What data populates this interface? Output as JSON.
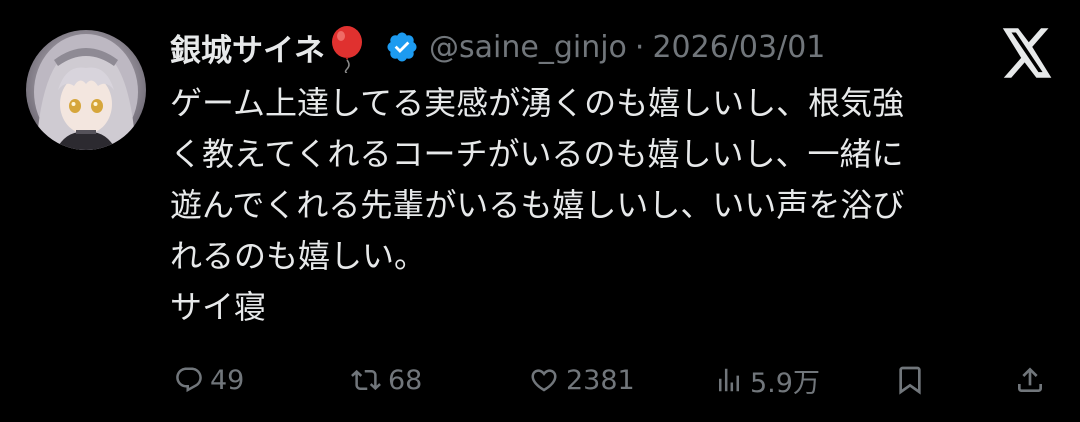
{
  "user": {
    "display_name": "銀城サイネ",
    "handle": "@saine_ginjo",
    "separator": "·",
    "date": "2026/03/01",
    "verified": true,
    "name_emoji": "balloon-icon"
  },
  "tweet": {
    "lines": [
      "ゲーム上達してる実感が湧くのも嬉しいし、根気強",
      "く教えてくれるコーチがいるのも嬉しいし、一緒に",
      "遊んでくれる先輩がいるも嬉しいし、いい声を浴び",
      "れるのも嬉しい。",
      "サイ寝"
    ]
  },
  "actions": {
    "replies": "49",
    "reposts": "68",
    "likes": "2381",
    "views": "5.9万"
  },
  "colors": {
    "background": "#000000",
    "text": "#e7e9ea",
    "muted": "#71767b",
    "verified": "#1d9bf0",
    "balloon": "#e0312f"
  },
  "icons": [
    "reply-icon",
    "repost-icon",
    "like-icon",
    "views-icon",
    "bookmark-icon",
    "share-icon",
    "x-logo-icon",
    "verified-badge-icon"
  ]
}
